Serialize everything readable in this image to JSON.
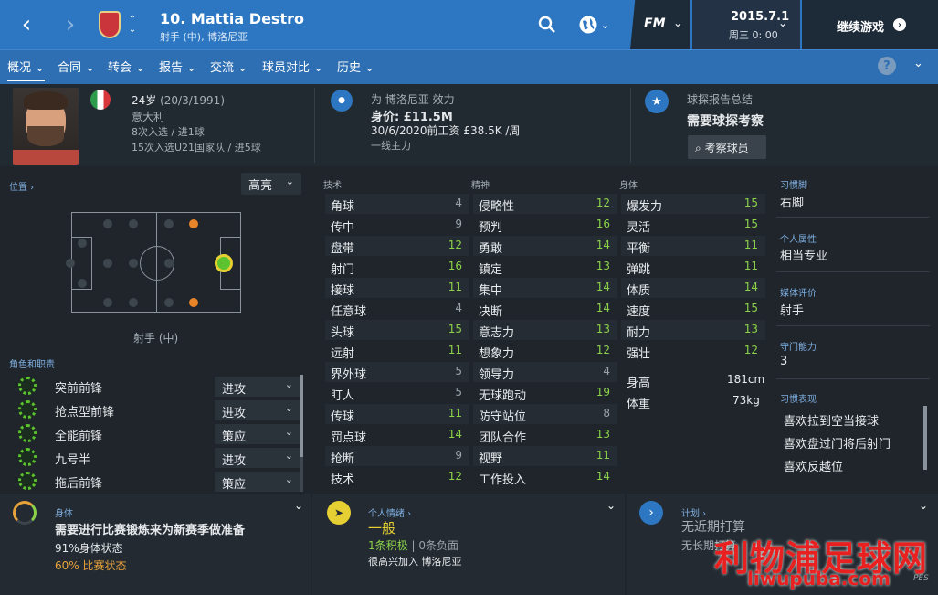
{
  "top": {
    "player_name": "10. Mattia Destro",
    "player_sub": "射手 (中), 博洛尼亚",
    "date": "2015.7.1",
    "weekday": "周三 0: 00",
    "continue": "继续游戏",
    "fm": "FM"
  },
  "nav": [
    "概况",
    "合同",
    "转会",
    "报告",
    "交流",
    "球员对比",
    "历史"
  ],
  "header": {
    "age": "24岁",
    "dob": "(20/3/1991)",
    "nation": "意大利",
    "caps": "8次入选 / 进1球",
    "u21": "15次入选U21国家队 / 进5球",
    "club": "为 博洛尼亚 效力",
    "value": "身价: £11.5M",
    "contract": "30/6/2020前工资 £38.5K /周",
    "status": "一线主力",
    "scout_title": "球探报告总结",
    "scout_need": "需要球探考察",
    "scout_btn": "考察球员"
  },
  "left": {
    "position_label": "位置",
    "view": "高亮",
    "position_name": "射手 (中)",
    "roles_label": "角色和职责",
    "roles": [
      {
        "name": "突前前锋",
        "duty": "进攻"
      },
      {
        "name": "抢点型前锋",
        "duty": "进攻"
      },
      {
        "name": "全能前锋",
        "duty": "策应"
      },
      {
        "name": "九号半",
        "duty": "进攻"
      },
      {
        "name": "拖后前锋",
        "duty": "策应"
      }
    ]
  },
  "attributes": {
    "tech_label": "技术",
    "mental_label": "精神",
    "physical_label": "身体",
    "technical": [
      [
        "角球",
        "4"
      ],
      [
        "传中",
        "9"
      ],
      [
        "盘带",
        "12"
      ],
      [
        "射门",
        "16"
      ],
      [
        "接球",
        "11"
      ],
      [
        "任意球",
        "4"
      ],
      [
        "头球",
        "15"
      ],
      [
        "远射",
        "11"
      ],
      [
        "界外球",
        "5"
      ],
      [
        "盯人",
        "5"
      ],
      [
        "传球",
        "11"
      ],
      [
        "罚点球",
        "14"
      ],
      [
        "抢断",
        "9"
      ],
      [
        "技术",
        "12"
      ]
    ],
    "mental": [
      [
        "侵略性",
        "12"
      ],
      [
        "预判",
        "16"
      ],
      [
        "勇敢",
        "14"
      ],
      [
        "镇定",
        "13"
      ],
      [
        "集中",
        "14"
      ],
      [
        "决断",
        "14"
      ],
      [
        "意志力",
        "13"
      ],
      [
        "想象力",
        "12"
      ],
      [
        "领导力",
        "4"
      ],
      [
        "无球跑动",
        "19"
      ],
      [
        "防守站位",
        "8"
      ],
      [
        "团队合作",
        "13"
      ],
      [
        "视野",
        "11"
      ],
      [
        "工作投入",
        "14"
      ]
    ],
    "physical": [
      [
        "爆发力",
        "15"
      ],
      [
        "灵活",
        "15"
      ],
      [
        "平衡",
        "11"
      ],
      [
        "弹跳",
        "11"
      ],
      [
        "体质",
        "14"
      ],
      [
        "速度",
        "15"
      ],
      [
        "耐力",
        "13"
      ],
      [
        "强壮",
        "12"
      ]
    ],
    "height_label": "身高",
    "height": "181cm",
    "weight_label": "体重",
    "weight": "73kg"
  },
  "right": {
    "foot_label": "习惯脚",
    "foot": "右脚",
    "personality_label": "个人属性",
    "personality": "相当专业",
    "media_label": "媒体评价",
    "media": "射手",
    "gk_label": "守门能力",
    "gk": "3",
    "traits_label": "习惯表现",
    "traits": [
      "喜欢拉到空当接球",
      "喜欢盘过门将后射门",
      "喜欢反越位"
    ]
  },
  "bottom": {
    "fitness_label": "身体",
    "fitness_title": "需要进行比赛锻炼来为新赛季做准备",
    "fitness_pct": "91%身体状态",
    "match_pct": "60% 比赛状态",
    "morale_label": "个人情绪",
    "morale": "一般",
    "morale_pos": "1条积极",
    "morale_neg": "0条负面",
    "morale_note": "很高兴加入 博洛尼亚",
    "plan_label": "计划",
    "plan_title": "无近期打算",
    "plan_sub": "无长期打算"
  },
  "watermark": {
    "cn": "利物浦足球网",
    "url": "liwupuba.com",
    "tag": "PES"
  },
  "colors": {
    "accent": "#2d77c2",
    "good": "#8bd24a",
    "warn": "#e8a23a"
  }
}
